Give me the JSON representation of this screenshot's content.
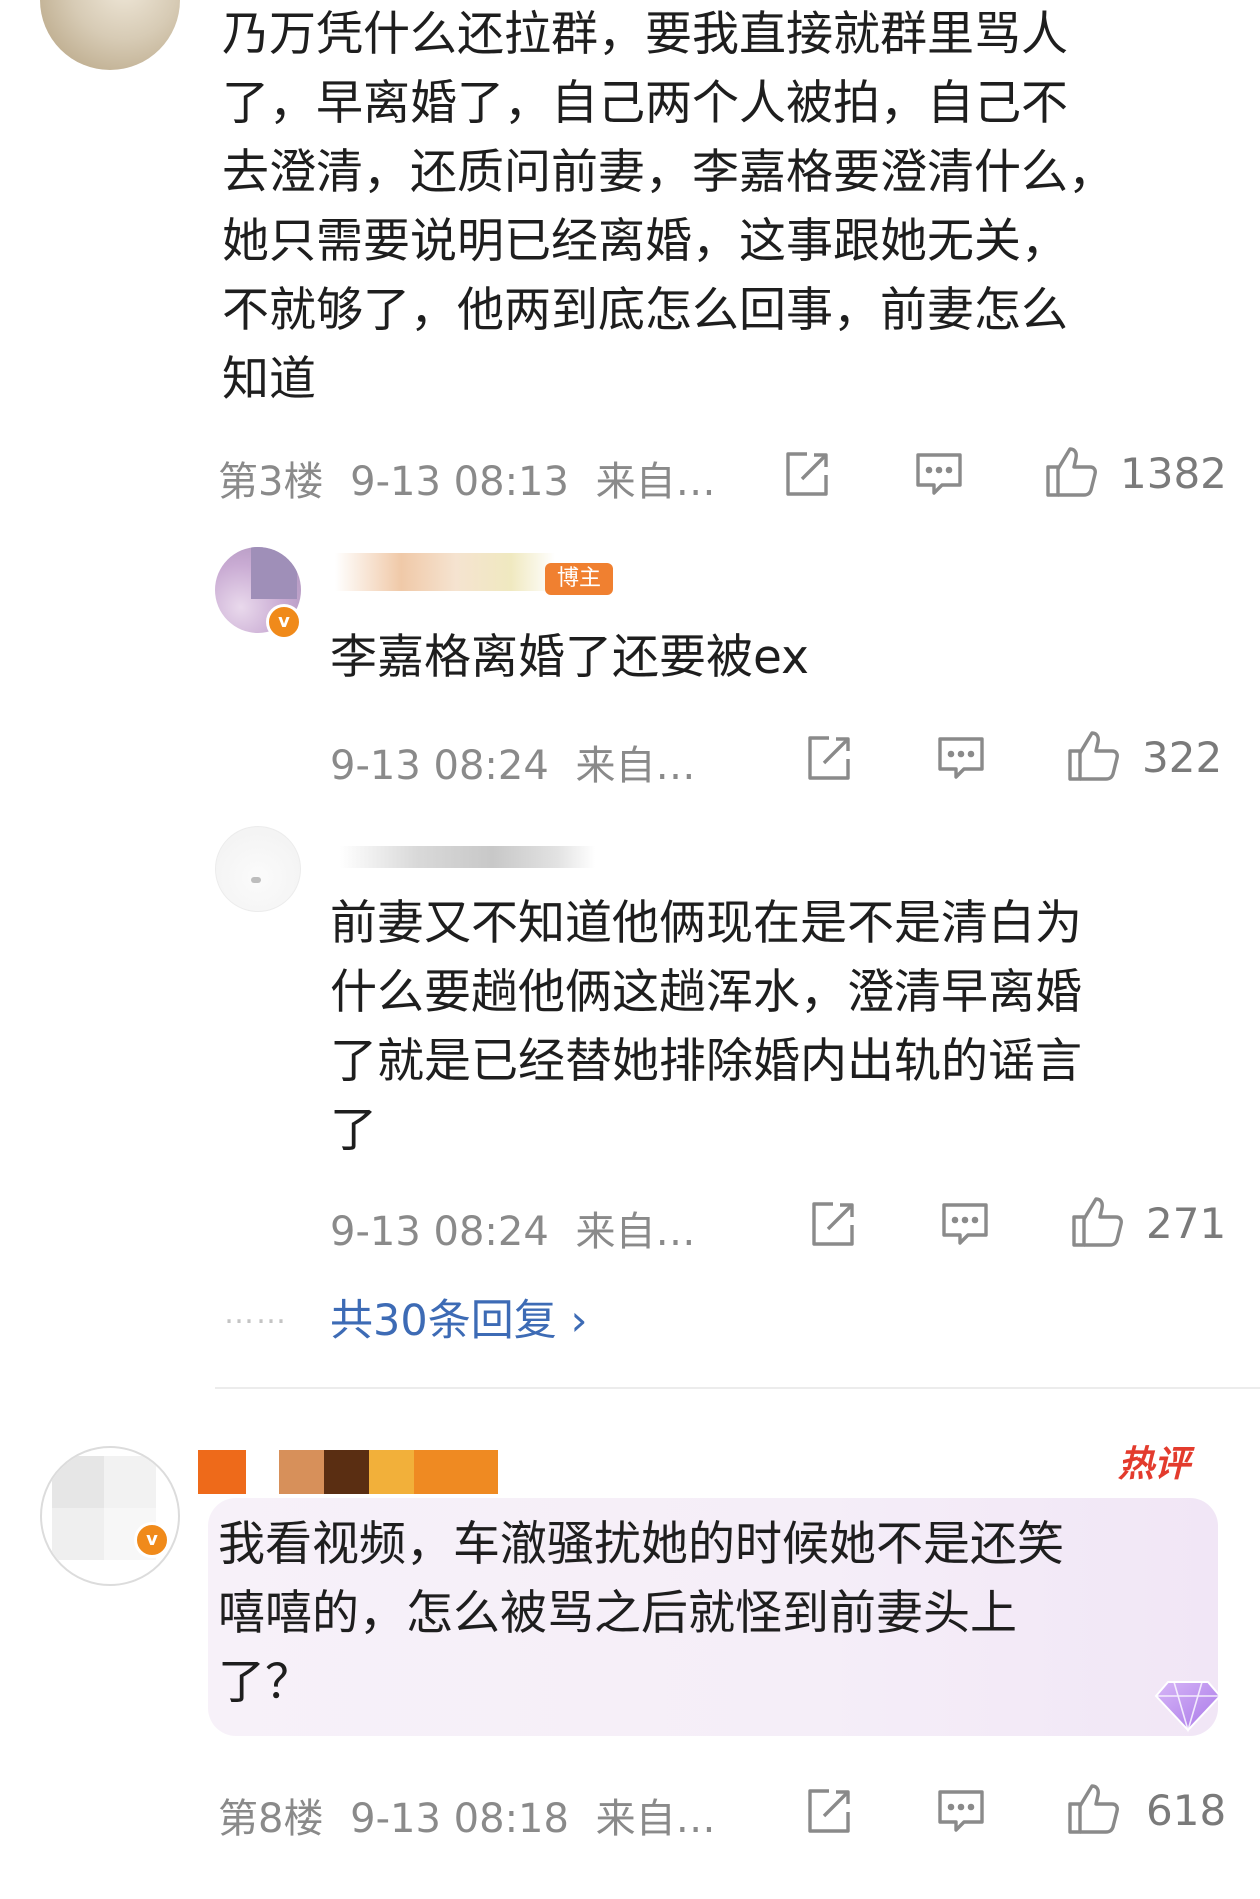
{
  "comments": [
    {
      "lines": [
        "乃万凭什么还拉群，要我直接就群里骂人",
        "了，早离婚了，自己两个人被拍，自己不",
        "去澄清，还质问前妻，李嘉格要澄清什么，",
        "她只需要说明已经离婚，这事跟她无关，",
        "不就够了，他两到底怎么回事，前妻怎么",
        "知道"
      ],
      "floor": "第3楼",
      "time": "9-13 08:13",
      "source": "来自…",
      "likes": "1382"
    },
    {
      "lines": [
        "我看视频，车澈骚扰她的时候她不是还笑",
        "嘻嘻的，怎么被骂之后就怪到前妻头上",
        "了？"
      ],
      "floor": "第8楼",
      "time": "9-13 08:18",
      "source": "来自…",
      "likes": "618",
      "hot_label": "热评"
    }
  ],
  "replies": [
    {
      "host_tag": "博主",
      "lines": [
        "李嘉格离婚了还要被ex"
      ],
      "time": "9-13 08:24",
      "source": "来自…",
      "likes": "322"
    },
    {
      "lines": [
        "前妻又不知道他俩现在是不是清白为",
        "什么要趟他俩这趟浑水，澄清早离婚",
        "了就是已经替她排除婚内出轨的谣言",
        "了"
      ],
      "time": "9-13 08:24",
      "source": "来自…",
      "likes": "271"
    }
  ],
  "more_replies": {
    "dots": "……",
    "label": "共30条回复 ›"
  },
  "badges": {
    "verified": "v"
  },
  "icons": [
    "share-icon",
    "comment-icon",
    "like-icon"
  ],
  "colors": {
    "link": "#3d6bb5",
    "meta": "#8a8a8a",
    "verified_badge": "#f08a1a",
    "hot": "#e33b2d"
  }
}
